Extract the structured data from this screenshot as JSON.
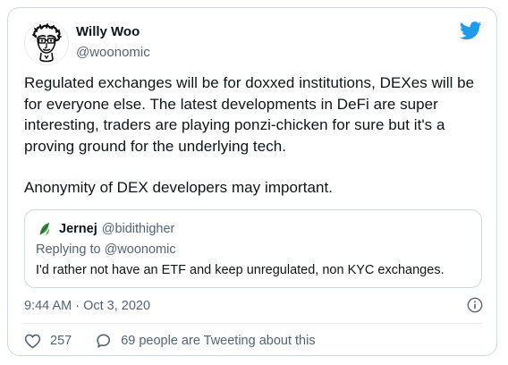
{
  "tweet": {
    "author": {
      "name": "Willy Woo",
      "handle": "@woonomic"
    },
    "paragraphs": [
      "Regulated exchanges will be for doxxed institutions, DEXes will be for everyone else. The latest developments in DeFi are super interesting, traders are playing ponzi-chicken for sure but it's a proving ground for the underlying tech.",
      "Anonymity of DEX developers may important."
    ],
    "timestamp": "9:44 AM · Oct 3, 2020",
    "likes": "257",
    "conversation": "69 people are Tweeting about this"
  },
  "quote": {
    "author": {
      "name": "Jernej",
      "handle": "@bidithigher"
    },
    "replying_to": "Replying to @woonomic",
    "text": "I'd rather not have an ETF and keep unregulated, non KYC exchanges."
  },
  "icons": {
    "brand": "twitter-bird-icon",
    "info": "info-icon",
    "like": "heart-icon",
    "conversation": "comment-icon"
  },
  "colors": {
    "brand": "#1d9bf0",
    "text": "#0f1419",
    "secondary": "#536471",
    "border": "#cfd9de"
  }
}
